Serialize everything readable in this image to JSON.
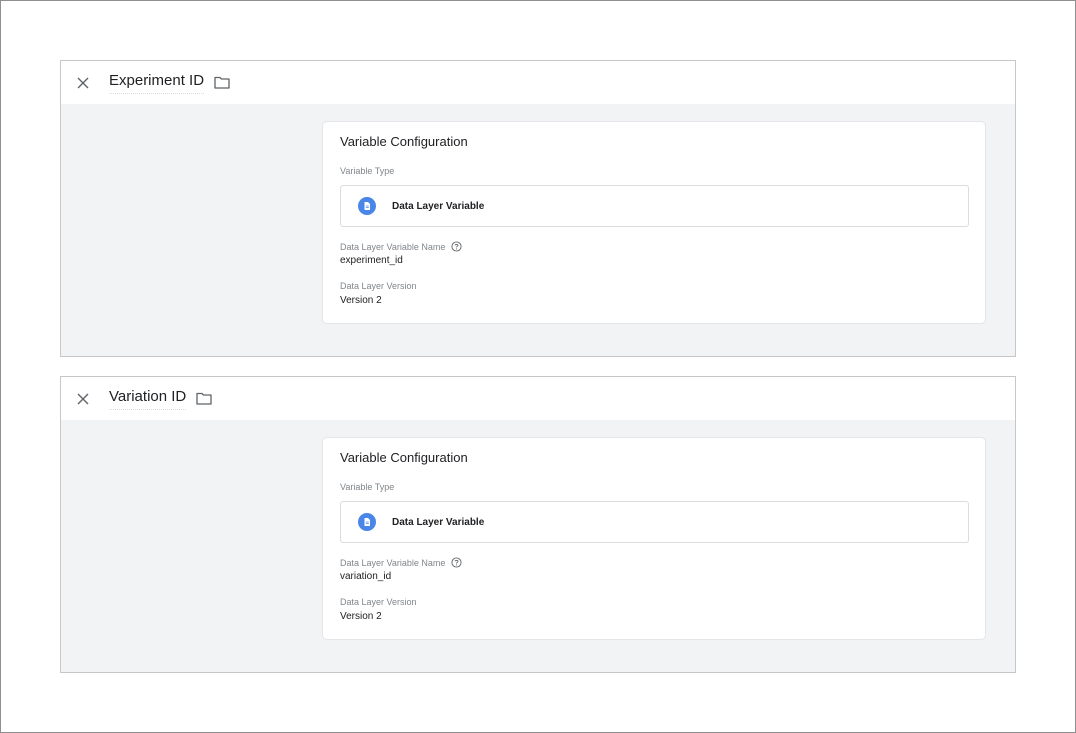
{
  "panels": [
    {
      "title": "Experiment ID",
      "card": {
        "title": "Variable Configuration",
        "variable_type_label": "Variable Type",
        "variable_type": "Data Layer Variable",
        "name_label": "Data Layer Variable Name",
        "name_value": "experiment_id",
        "version_label": "Data Layer Version",
        "version_value": "Version 2"
      }
    },
    {
      "title": "Variation ID",
      "card": {
        "title": "Variable Configuration",
        "variable_type_label": "Variable Type",
        "variable_type": "Data Layer Variable",
        "name_label": "Data Layer Variable Name",
        "name_value": "variation_id",
        "version_label": "Data Layer Version",
        "version_value": "Version 2"
      }
    }
  ],
  "icons": {
    "close": "close-icon",
    "folder": "folder-icon",
    "variable_type": "document-icon",
    "help": "help-circle-icon"
  },
  "colors": {
    "accent": "#4a86e8",
    "panel_background": "#f1f3f4"
  }
}
